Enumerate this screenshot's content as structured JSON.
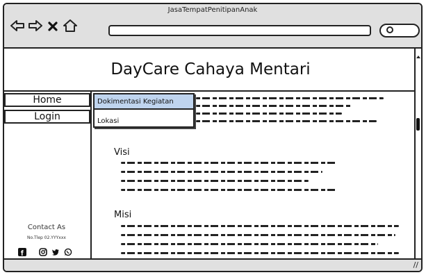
{
  "window": {
    "title": "JasaTempatPenitipanAnak"
  },
  "header": {
    "site_title": "DayCare Cahaya Mentari"
  },
  "sidebar": {
    "items": [
      {
        "label": "Home"
      },
      {
        "label": "Login"
      }
    ],
    "contact_title": "Contact As",
    "contact_phone": "No.Tlep 02.YYYxxx"
  },
  "dropdown": {
    "items": [
      {
        "label": "Dokimentasi Kegiatan",
        "active": true
      },
      {
        "label": "Lokasi",
        "active": false
      }
    ]
  },
  "main": {
    "sections": [
      {
        "heading": "Visi"
      },
      {
        "heading": "Misi"
      }
    ]
  },
  "icons": {
    "back": "arrow-left-icon",
    "forward": "arrow-right-icon",
    "close": "close-icon",
    "home": "home-icon",
    "search": "search-icon",
    "social": [
      "facebook-icon",
      "instagram-icon",
      "twitter-icon",
      "whatsapp-icon"
    ]
  },
  "colors": {
    "chrome": "#e0e0e0",
    "dropdown_highlight": "#bfd4ee",
    "ink": "#222222"
  }
}
